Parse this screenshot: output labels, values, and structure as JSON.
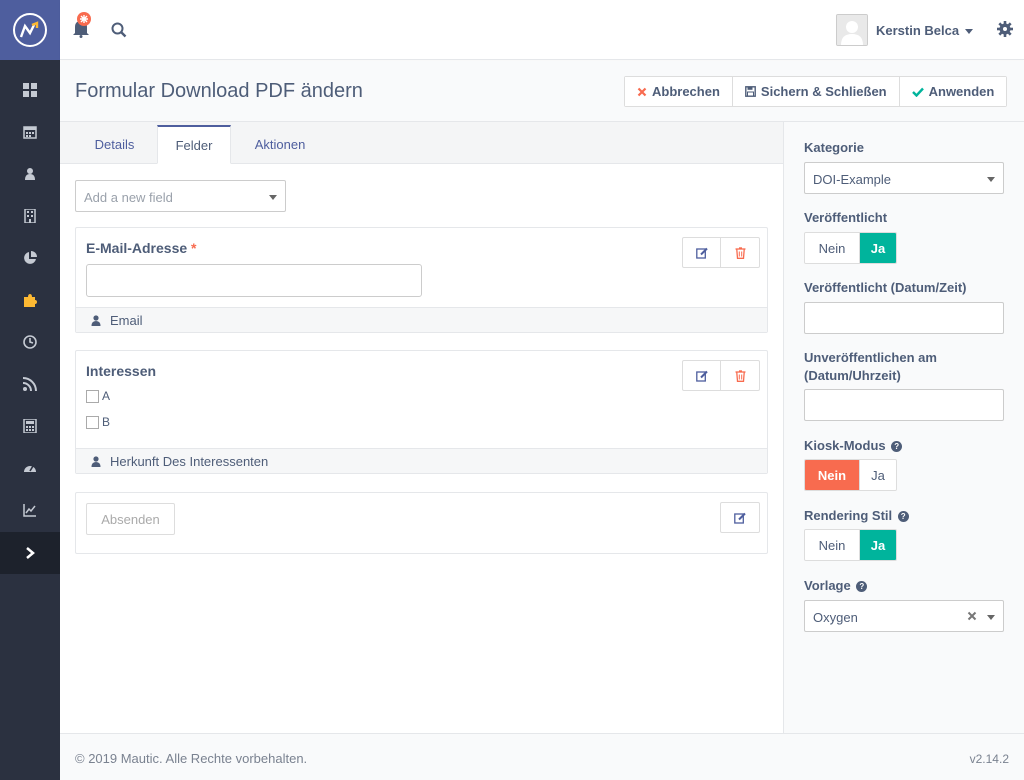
{
  "topbar": {
    "notification_count": "",
    "user_name": "Kerstin Belca"
  },
  "page": {
    "title": "Formular Download PDF ändern"
  },
  "actions": {
    "cancel_label": "Abbrechen",
    "save_close_label": "Sichern & Schließen",
    "apply_label": "Anwenden"
  },
  "tabs": [
    {
      "label": "Details"
    },
    {
      "label": "Felder"
    },
    {
      "label": "Aktionen"
    }
  ],
  "field_select": {
    "placeholder": "Add a new field"
  },
  "fields": {
    "email": {
      "title": "E-Mail-Adresse",
      "required_mark": "*",
      "mapped_to": "Email"
    },
    "interests": {
      "title": "Interessen",
      "options": [
        "A",
        "B"
      ],
      "mapped_to": "Herkunft Des Interessenten"
    },
    "submit": {
      "label": "Absenden"
    }
  },
  "right_panel": {
    "category_label": "Kategorie",
    "category_value": "DOI-Example",
    "published_label": "Veröffentlicht",
    "published_date_label": "Veröffentlicht (Datum/Zeit)",
    "unpublish_label_line1": "Unveröffentlichen am",
    "unpublish_label_line2": "(Datum/Uhrzeit)",
    "kiosk_label": "Kiosk-Modus",
    "rendering_label": "Rendering Stil",
    "template_label": "Vorlage",
    "template_value": "Oxygen",
    "no_label": "Nein",
    "yes_label": "Ja"
  },
  "footer": {
    "copyright": "© 2019 Mautic. Alle Rechte vorbehalten.",
    "version": "v2.14.2"
  },
  "colors": {
    "sidebar": "#2b3140",
    "brand": "#4e5e9e",
    "accent_green": "#00b49c",
    "accent_red": "#f86b4f",
    "logo_accent": "#fdb933"
  },
  "icons": {
    "sidebar": [
      "dashboard-icon",
      "calendar-icon",
      "user-icon",
      "building-icon",
      "pie-chart-icon",
      "puzzle-icon",
      "clock-icon",
      "rss-icon",
      "calculator-icon",
      "speedometer-icon",
      "line-chart-icon",
      "chevron-right-icon"
    ]
  }
}
